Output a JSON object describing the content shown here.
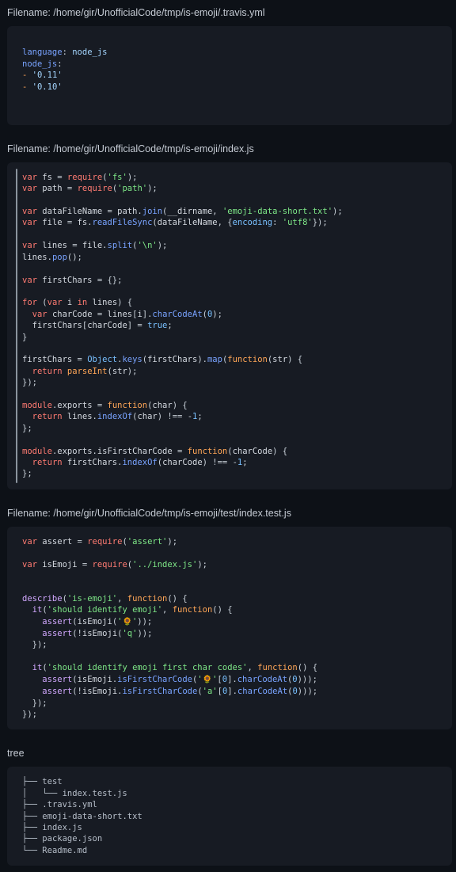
{
  "theme": {
    "page_bg": "#0d1117",
    "code_bg": "#171b23",
    "text": "#c9d1d9",
    "keyword": "#ff7b72",
    "string": "#7ee787",
    "function": "#d2a8ff",
    "method": "#79a3ff",
    "number": "#79c0ff",
    "orange": "#ffa657"
  },
  "sections": [
    {
      "id": "travis",
      "label": "Filename: /home/gir/UnofficialCode/tmp/is-emoji/.travis.yml",
      "language": "yaml",
      "has_rule": false,
      "code_text": "language: node_js\nnode_js:\n - '0.11'\n - '0.10'"
    },
    {
      "id": "index",
      "label": "Filename: /home/gir/UnofficialCode/tmp/is-emoji/index.js",
      "language": "javascript",
      "has_rule": true,
      "code_text": "var fs = require('fs');\nvar path = require('path');\n\nvar dataFileName = path.join(__dirname, 'emoji-data-short.txt');\nvar file = fs.readFileSync(dataFileName, {encoding: 'utf8'});\n\nvar lines = file.split('\\n');\nlines.pop();\n\nvar firstChars = {};\n\nfor (var i in lines) {\n  var charCode = lines[i].charCodeAt(0);\n  firstChars[charCode] = true;\n}\n\nfirstChars = Object.keys(firstChars).map(function(str) {\n  return parseInt(str);\n});\n\nmodule.exports = function(char) {\n  return lines.indexOf(char) !== -1;\n};\n\nmodule.exports.isFirstCharCode = function(charCode) {\n  return firstChars.indexOf(charCode) !== -1;\n};"
    },
    {
      "id": "test",
      "label": "Filename: /home/gir/UnofficialCode/tmp/is-emoji/test/index.test.js",
      "language": "javascript",
      "has_rule": false,
      "code_text": "var assert = require('assert');\n\nvar isEmoji = require('../index.js');\n\n\ndescribe('is-emoji', function() {\n  it('should identify emoji', function() {\n    assert(isEmoji('🌻'));\n    assert(!isEmoji('q'));\n  });\n\n  it('should identify emoji first char codes', function() {\n    assert(isEmoji.isFirstCharCode('🌻'[0].charCodeAt(0)));\n    assert(!isEmoji.isFirstCharCode('a'[0].charCodeAt(0)));\n  });\n});"
    },
    {
      "id": "tree",
      "label": "tree",
      "language": "text",
      "has_rule": false,
      "code_text": "├── test\n│   └── index.test.js\n├── .travis.yml\n├── emoji-data-short.txt\n├── index.js\n├── package.json\n└── Readme.md"
    }
  ],
  "tree_entries": [
    {
      "prefix": "├── ",
      "name": "test"
    },
    {
      "prefix": "│   └── ",
      "name": "index.test.js"
    },
    {
      "prefix": "├── ",
      "name": ".travis.yml"
    },
    {
      "prefix": "├── ",
      "name": "emoji-data-short.txt"
    },
    {
      "prefix": "├── ",
      "name": "index.js"
    },
    {
      "prefix": "├── ",
      "name": "package.json"
    },
    {
      "prefix": "└── ",
      "name": "Readme.md"
    }
  ],
  "emoji": "🌻"
}
